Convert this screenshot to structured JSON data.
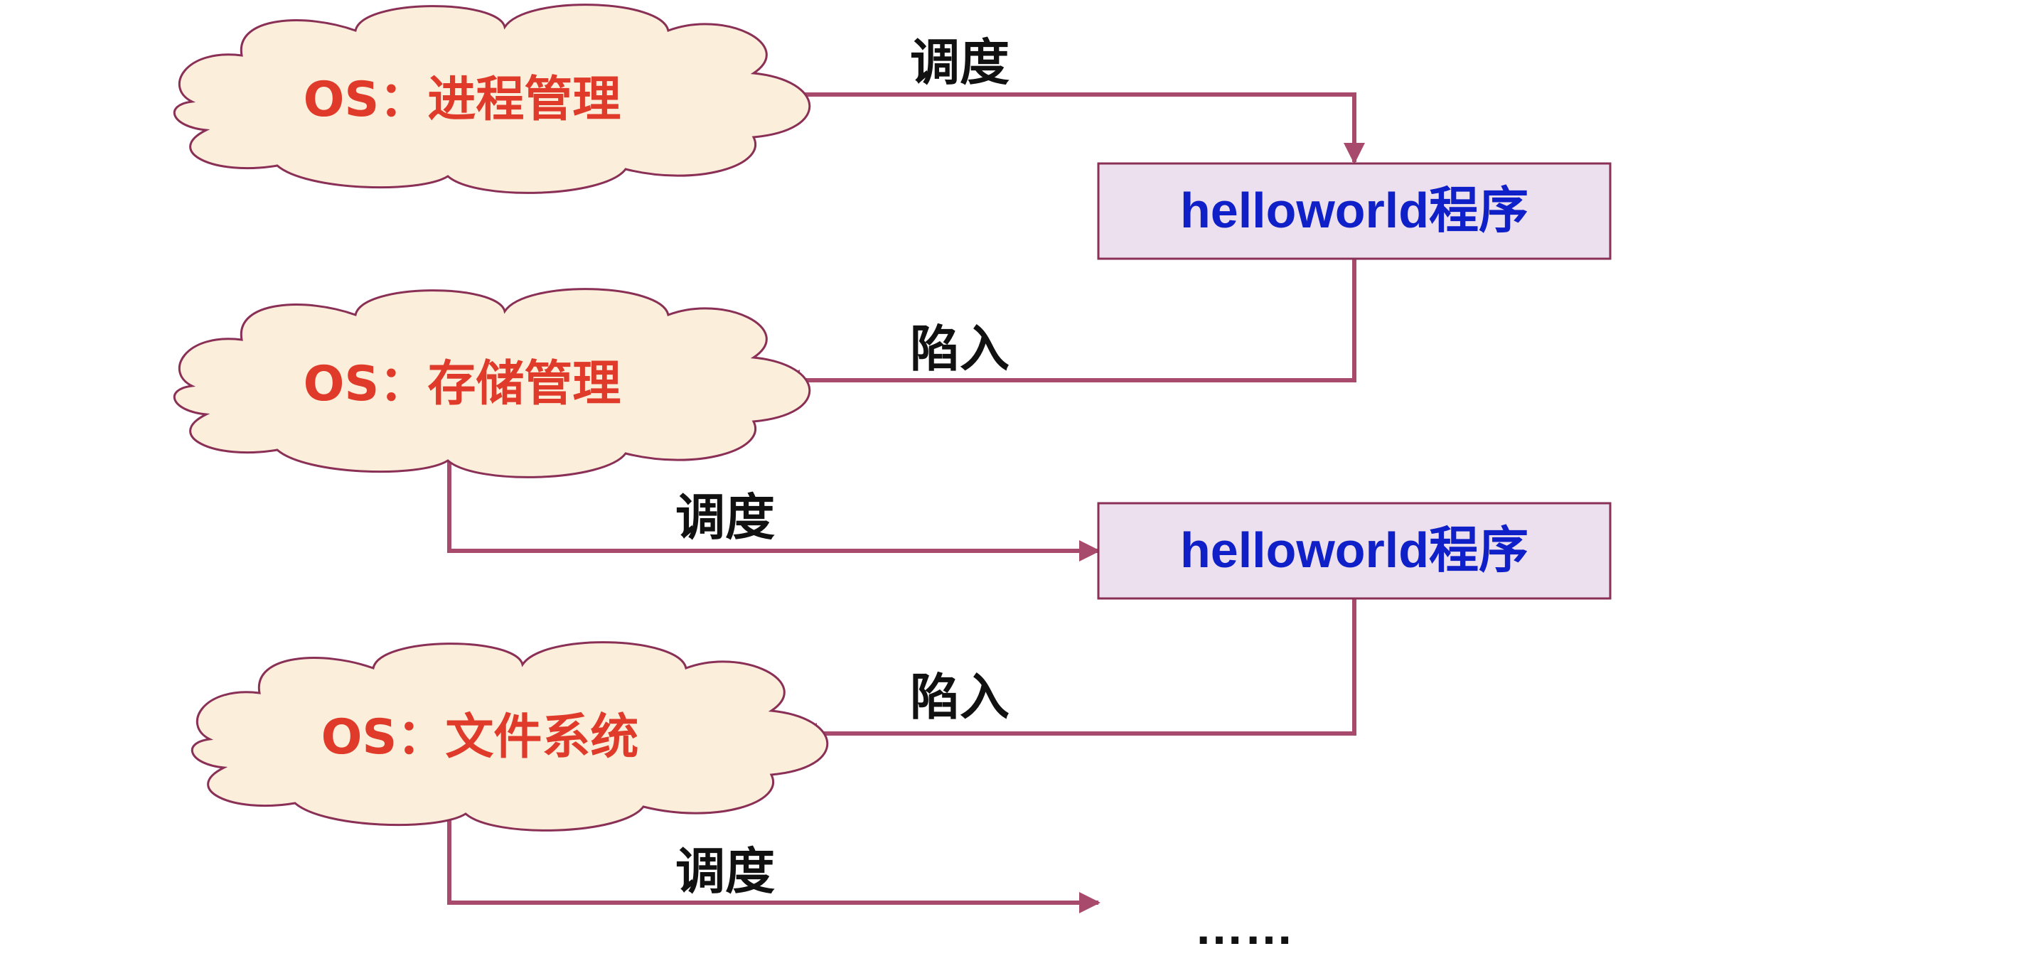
{
  "colors": {
    "cloud_fill": "#fbeedb",
    "cloud_stroke": "#8a2f55",
    "cloud_text": "#e03a2a",
    "arrow": "#a84a6c",
    "box_fill": "#ece0ee",
    "box_stroke": "#8a2f55",
    "box_text": "#1020c8",
    "label_text": "#111111"
  },
  "clouds": [
    {
      "label": "OS：进程管理"
    },
    {
      "label": "OS：存储管理"
    },
    {
      "label": "OS：文件系统"
    }
  ],
  "boxes": [
    {
      "label": "helloworld程序"
    },
    {
      "label": "helloworld程序"
    }
  ],
  "edges": [
    {
      "from": "OS：进程管理",
      "to": "helloworld程序",
      "label": "调度"
    },
    {
      "from": "helloworld程序",
      "to": "OS：存储管理",
      "label": "陷入"
    },
    {
      "from": "OS：存储管理",
      "to": "helloworld程序",
      "label": "调度"
    },
    {
      "from": "helloworld程序",
      "to": "OS：文件系统",
      "label": "陷入"
    },
    {
      "from": "OS：文件系统",
      "to": "……",
      "label": "调度"
    }
  ],
  "continuation": "……"
}
